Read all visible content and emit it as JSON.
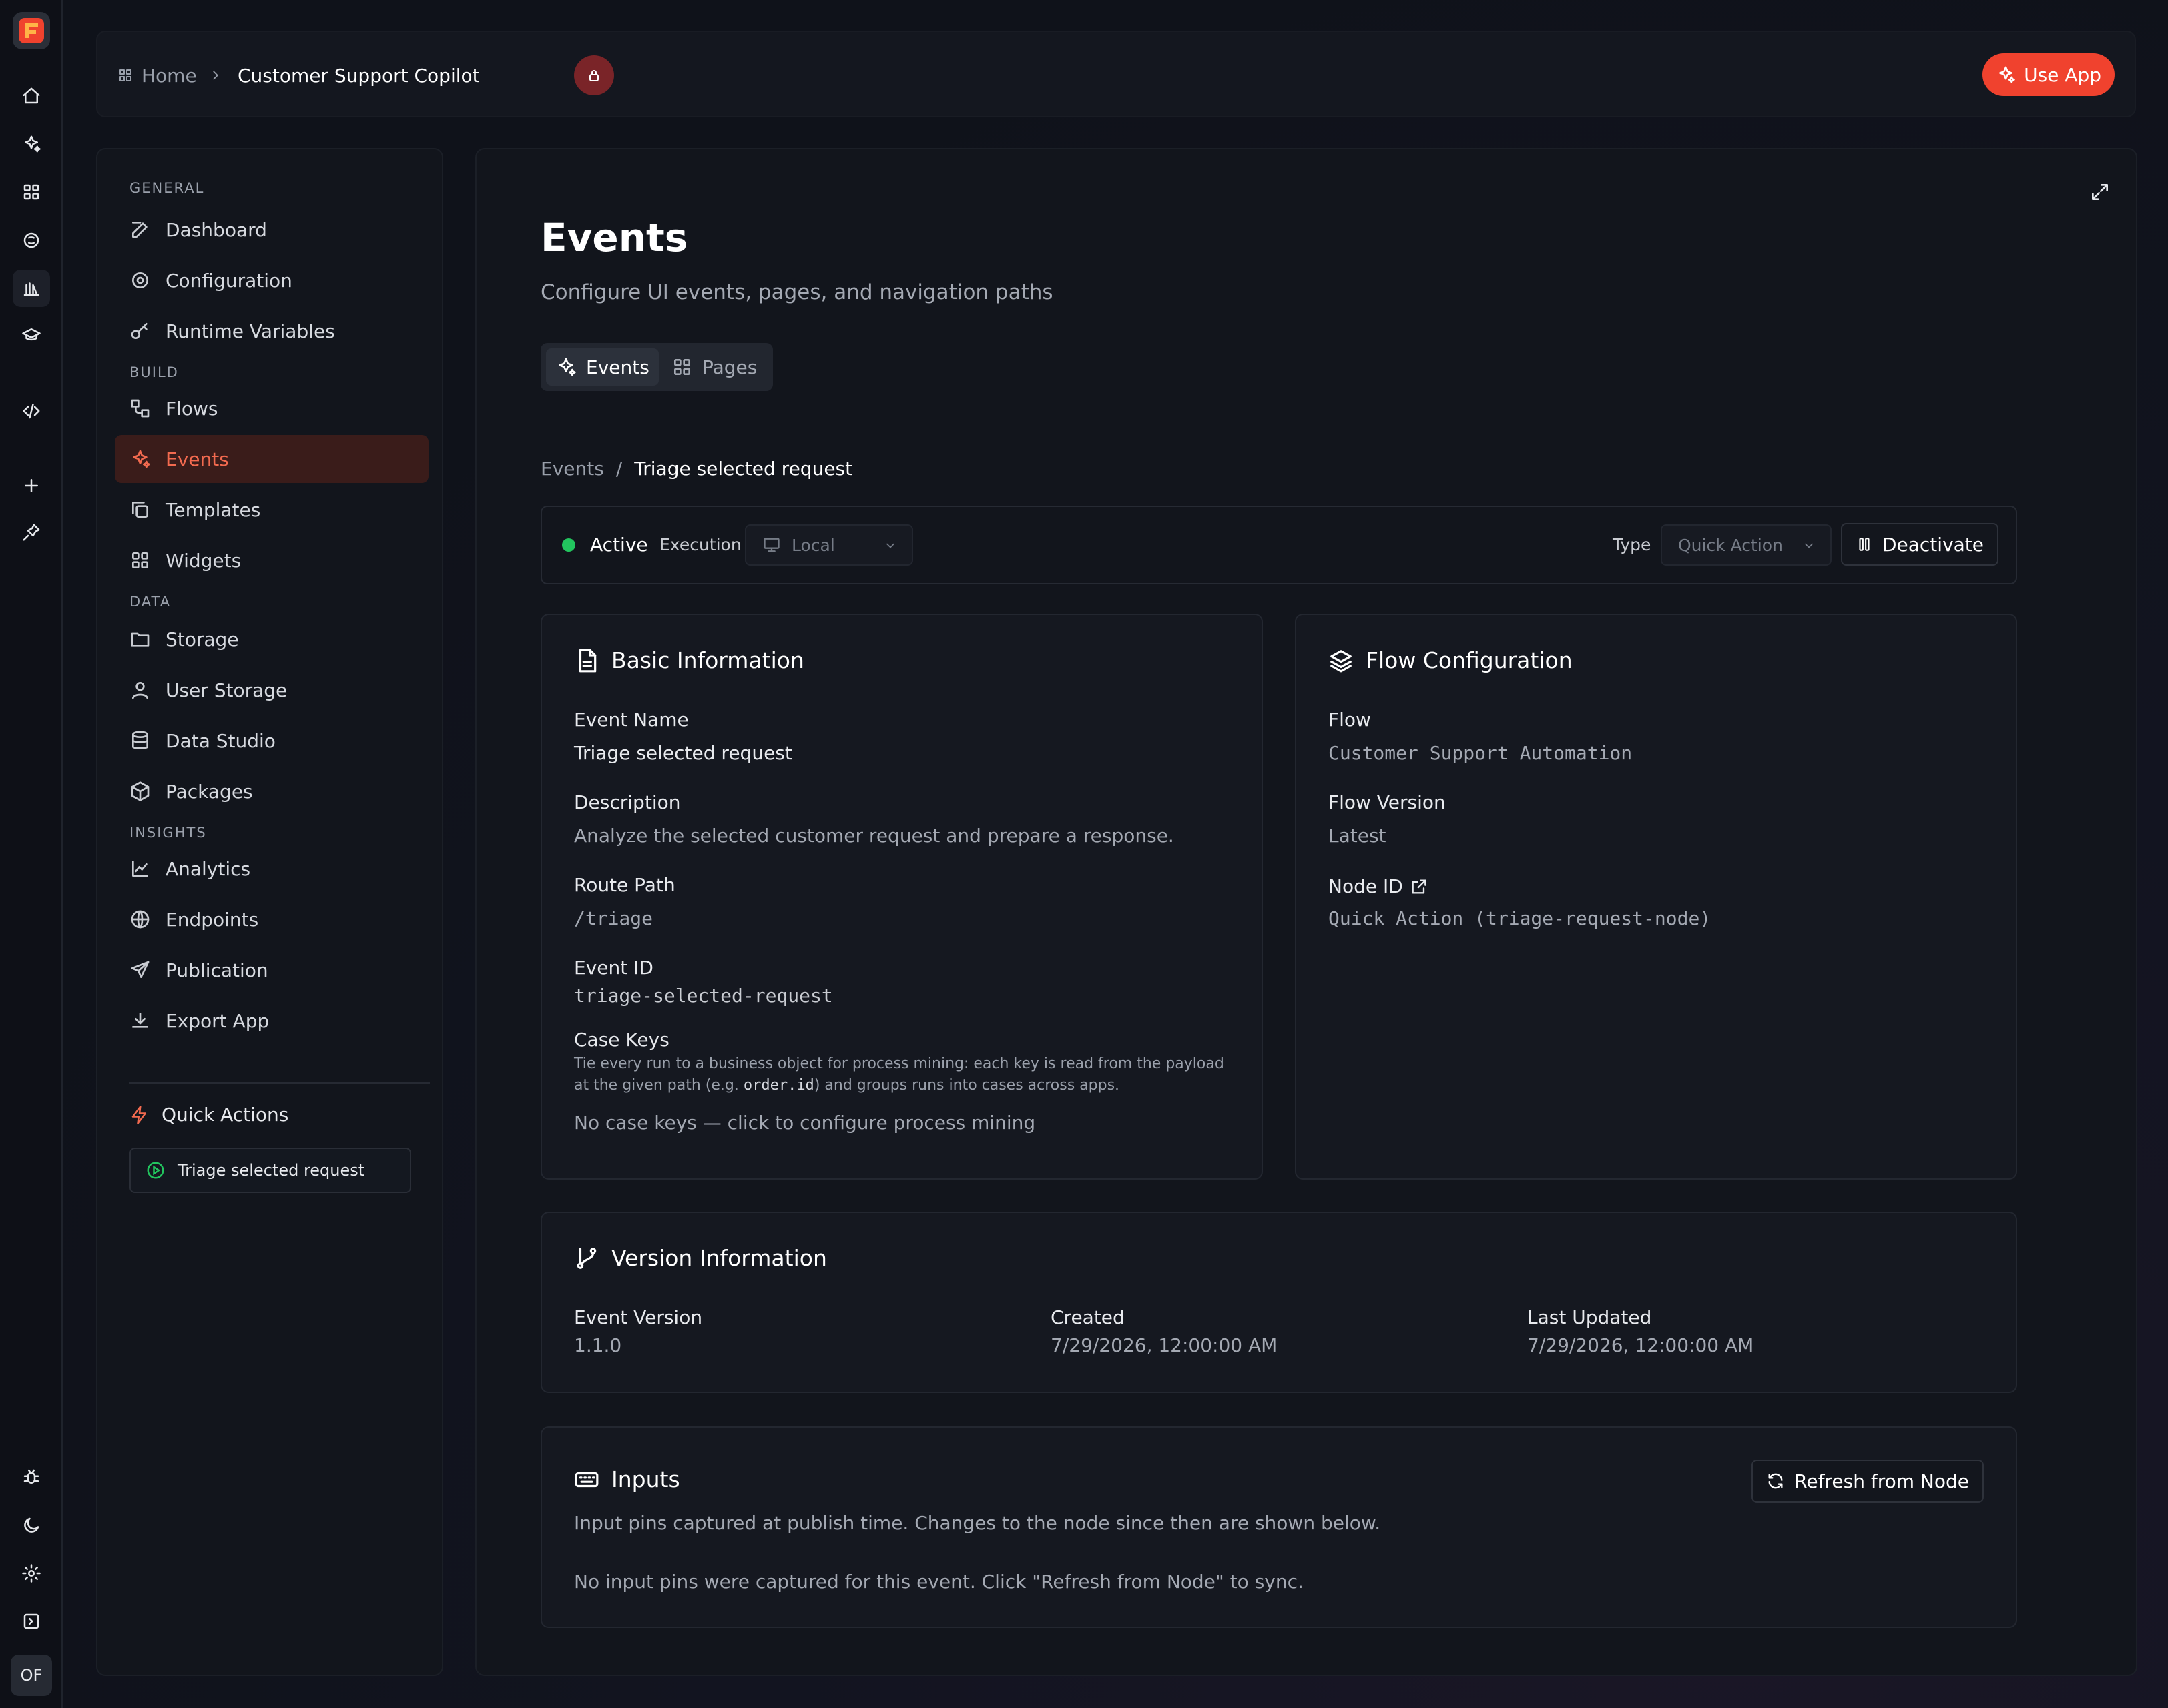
{
  "rail": {
    "items": [
      "home-icon",
      "sparkles-icon",
      "grid-icon",
      "brain-icon",
      "library-icon",
      "graduation-cap-icon",
      "code-icon",
      "plus-icon",
      "pin-icon"
    ],
    "bottom": [
      "bug-icon",
      "moon-icon",
      "settings-icon",
      "expand-panel-icon"
    ],
    "avatar": "OF"
  },
  "header": {
    "home": "Home",
    "app": "Customer Support Copilot",
    "use_app": "Use App",
    "accent": "#f0422e"
  },
  "sidebar": {
    "sections": {
      "general": "GENERAL",
      "build": "BUILD",
      "data": "DATA",
      "insights": "INSIGHTS"
    },
    "items": {
      "dashboard": "Dashboard",
      "configuration": "Configuration",
      "runtime": "Runtime Variables",
      "flows": "Flows",
      "events": "Events",
      "templates": "Templates",
      "widgets": "Widgets",
      "storage": "Storage",
      "user_storage": "User Storage",
      "data_studio": "Data Studio",
      "packages": "Packages",
      "analytics": "Analytics",
      "endpoints": "Endpoints",
      "publication": "Publication",
      "export": "Export App"
    },
    "quick_actions": {
      "title": "Quick Actions",
      "item": "Triage selected request"
    }
  },
  "main": {
    "title": "Events",
    "subtitle": "Configure UI events, pages, and navigation paths",
    "tabs": {
      "events": "Events",
      "pages": "Pages"
    },
    "crumb": {
      "root": "Events",
      "sep": "/",
      "current": "Triage selected request"
    },
    "status": {
      "active": "Active",
      "execution": "Execution",
      "execution_value": "Local",
      "type": "Type",
      "type_value": "Quick Action",
      "deactivate": "Deactivate",
      "active_color": "#22c55e"
    },
    "basic": {
      "title": "Basic Information",
      "event_name_label": "Event Name",
      "event_name": "Triage selected request",
      "description_label": "Description",
      "description": "Analyze the selected customer request and prepare a response.",
      "route_label": "Route Path",
      "route": "/triage",
      "event_id_label": "Event ID",
      "event_id": "triage-selected-request",
      "case_keys_label": "Case Keys",
      "case_keys_help_1": "Tie every run to a business object for process mining: each key is read from the payload",
      "case_keys_help_2a": "at the given path (e.g. ",
      "case_keys_help_code": "order.id",
      "case_keys_help_2b": ") and groups runs into cases across apps.",
      "case_keys_empty": "No case keys — click to configure process mining"
    },
    "flow": {
      "title": "Flow Configuration",
      "flow_label": "Flow",
      "flow": "Customer Support Automation",
      "version_label": "Flow Version",
      "version": "Latest",
      "node_label": "Node ID",
      "node": "Quick Action (triage-request-node)"
    },
    "version": {
      "title": "Version Information",
      "event_version_label": "Event Version",
      "event_version": "1.1.0",
      "created_label": "Created",
      "created": "7/29/2026, 12:00:00 AM",
      "updated_label": "Last Updated",
      "updated": "7/29/2026, 12:00:00 AM"
    },
    "inputs": {
      "title": "Inputs",
      "refresh": "Refresh from Node",
      "help": "Input pins captured at publish time. Changes to the node since then are shown below.",
      "empty": "No input pins were captured for this event. Click \"Refresh from Node\" to sync."
    }
  }
}
